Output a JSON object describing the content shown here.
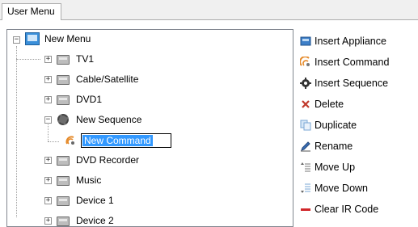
{
  "tab": {
    "label": "User Menu"
  },
  "tree": {
    "root": "New Menu",
    "items": [
      {
        "label": "TV1"
      },
      {
        "label": "Cable/Satellite"
      },
      {
        "label": "DVD1"
      },
      {
        "label": "New Sequence"
      },
      {
        "label": "New Command"
      },
      {
        "label": "DVD Recorder"
      },
      {
        "label": "Music"
      },
      {
        "label": "Device 1"
      },
      {
        "label": "Device 2"
      }
    ]
  },
  "actions": [
    {
      "label": "Insert Appliance",
      "icon": "appliance-icon"
    },
    {
      "label": "Insert Command",
      "icon": "command-icon"
    },
    {
      "label": "Insert Sequence",
      "icon": "sequence-icon"
    },
    {
      "label": "Delete",
      "icon": "delete-icon"
    },
    {
      "label": "Duplicate",
      "icon": "duplicate-icon"
    },
    {
      "label": "Rename",
      "icon": "rename-icon"
    },
    {
      "label": "Move Up",
      "icon": "move-up-icon"
    },
    {
      "label": "Move Down",
      "icon": "move-down-icon"
    },
    {
      "label": "Clear IR Code",
      "icon": "clear-ir-icon"
    }
  ],
  "colors": {
    "selection": "#3399ff",
    "accent": "#1e6fd0"
  }
}
